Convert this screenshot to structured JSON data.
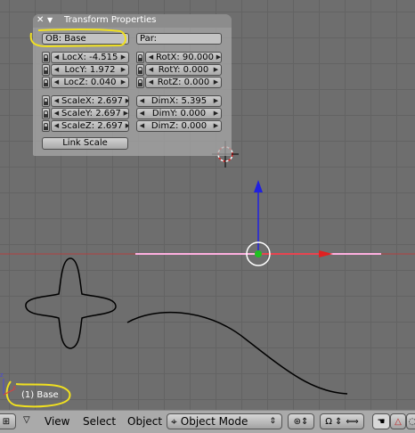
{
  "panel": {
    "title": "Transform Properties",
    "object_field": "OB: Base",
    "parent_field": "Par:",
    "location": [
      "LocX: -4.515",
      "LocY: 1.972",
      "LocZ: 0.040"
    ],
    "rotation": [
      "RotX: 90.000",
      "RotY: 0.000",
      "RotZ: 0.000"
    ],
    "scale": [
      "ScaleX: 2.697",
      "ScaleY: 2.697",
      "ScaleZ: 2.697"
    ],
    "dimensions": [
      "DimX: 5.395",
      "DimY: 0.000",
      "DimZ: 0.000"
    ],
    "link_scale_label": "Link Scale"
  },
  "viewport": {
    "object_label": "(1) Base",
    "axis_z_label": "z",
    "axis_x_label": "x"
  },
  "header": {
    "menus": [
      "View",
      "Select",
      "Object"
    ],
    "mode": "Object Mode"
  },
  "icons": {
    "close": "close-icon",
    "collapse": "triangle-down-icon",
    "lock": "lock-icon",
    "arrows": "arrow-left-right-icon",
    "cursor": "3d-cursor-icon",
    "hand": "hand-icon",
    "pivot": "pivot-icon",
    "manipulator": "manipulator-icon"
  },
  "colors": {
    "highlight": "#f0e020",
    "x_axis": "#e02020",
    "y_axis": "#20c020",
    "z_axis": "#2020e0",
    "selected": "#ffb0e0"
  }
}
